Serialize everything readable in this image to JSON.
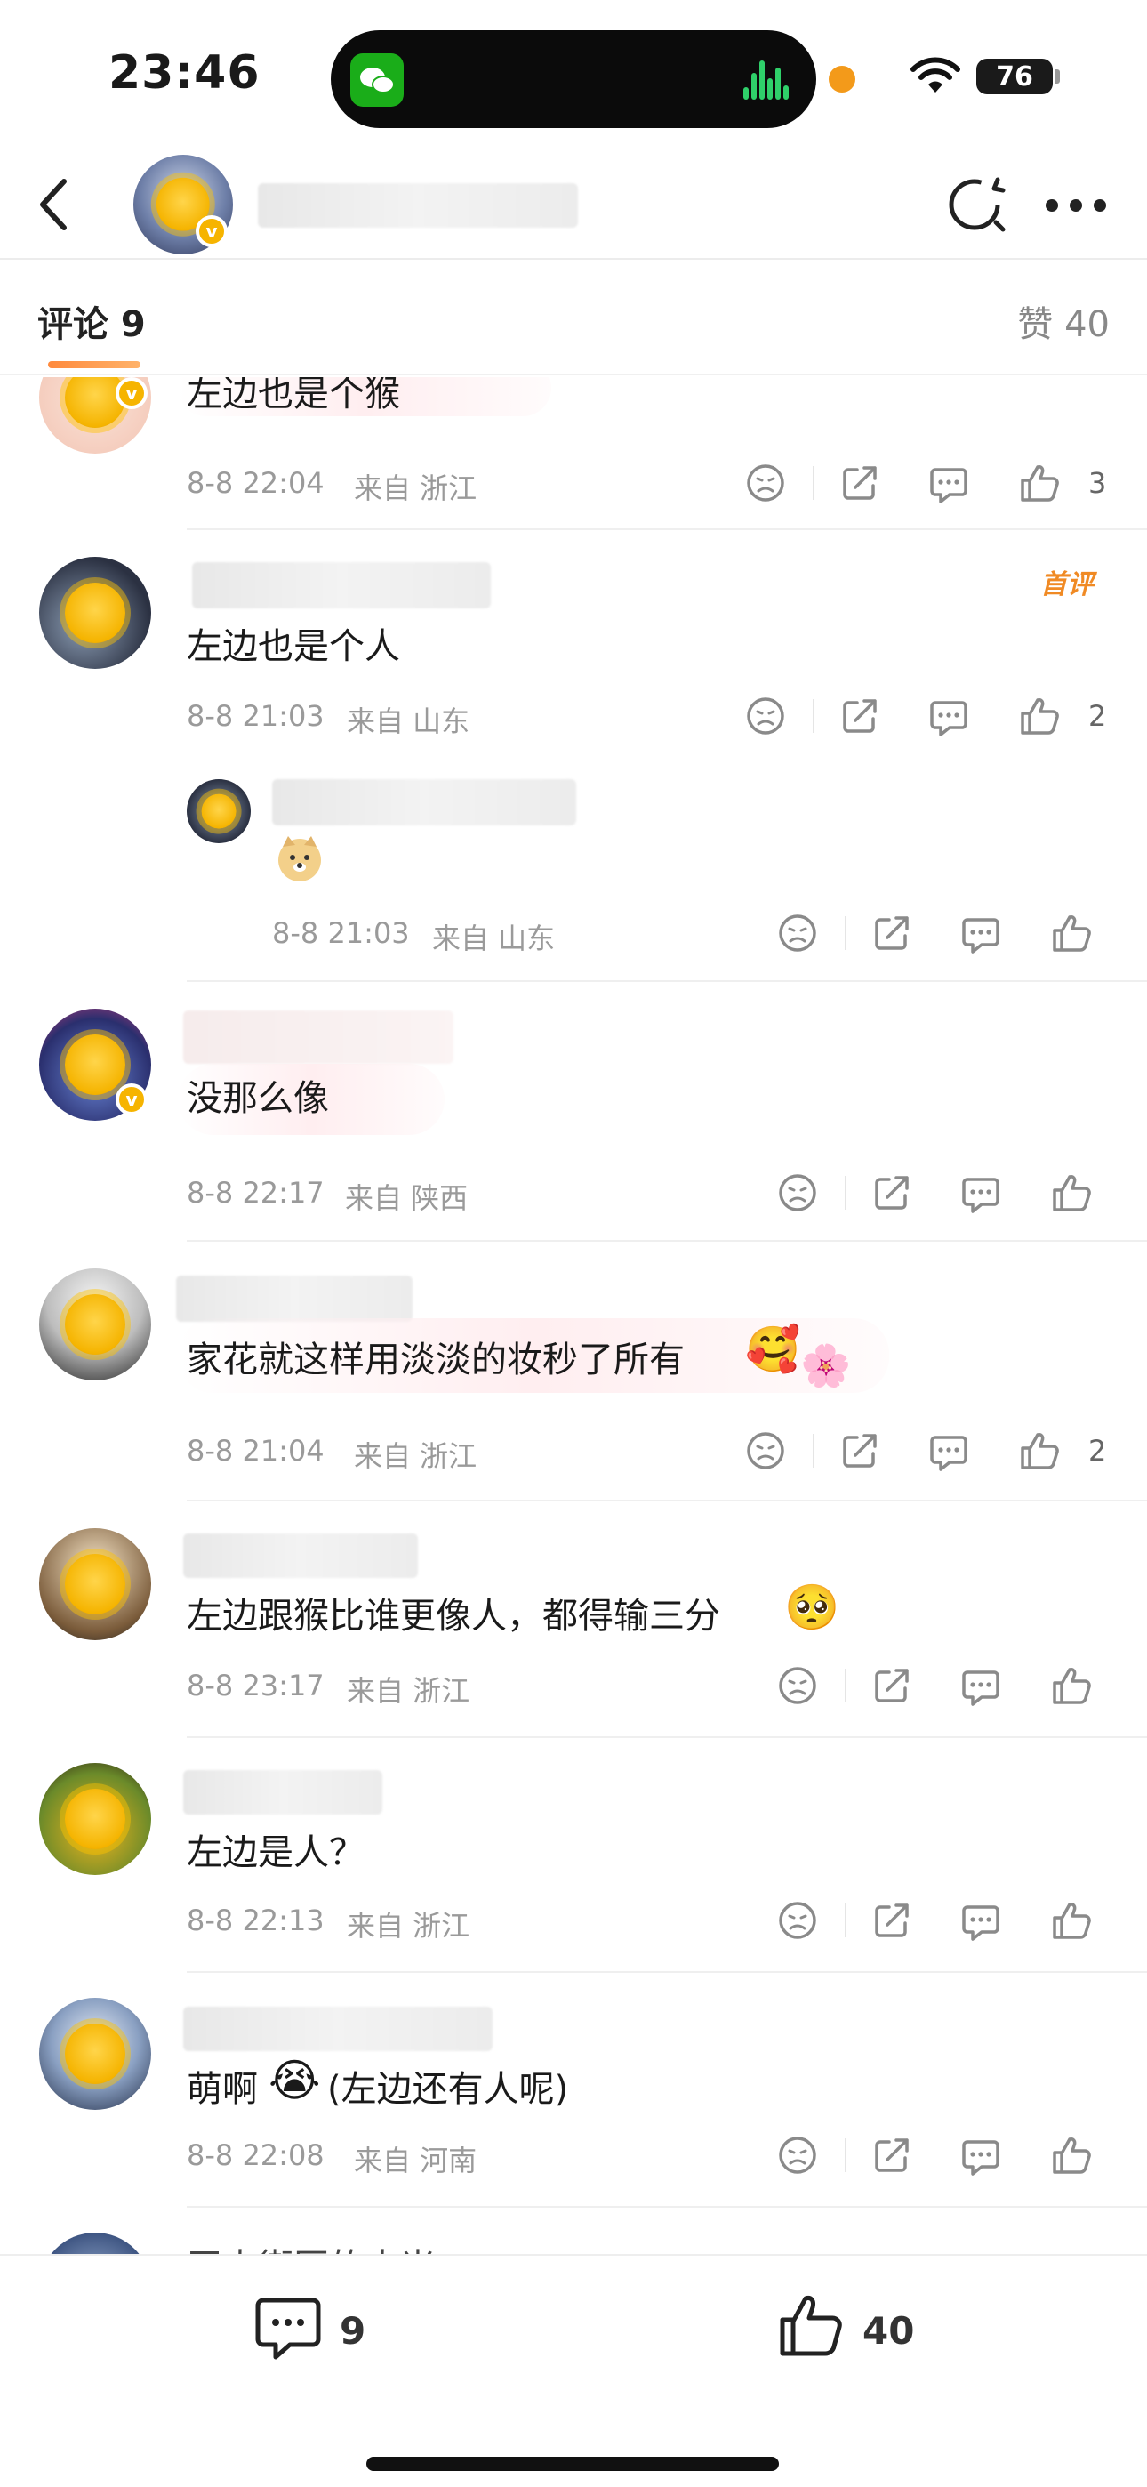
{
  "status": {
    "time": "23:46",
    "battery": "76"
  },
  "header": {
    "title": ""
  },
  "tabs": {
    "comments": "评论 9",
    "likes": "赞 40"
  },
  "comments": [
    {
      "text": "左边也是个猴",
      "time": "8-8 22:04",
      "location": "来自 浙江",
      "likes": "3"
    },
    {
      "text": "左边也是个人",
      "time": "8-8 21:03",
      "location": "来自 山东",
      "likes": "2",
      "badge": "首评"
    },
    {
      "text": "",
      "time": "8-8 21:03",
      "location": "来自 山东",
      "likes": ""
    },
    {
      "text": "没那么像",
      "time": "8-8 22:17",
      "location": "来自 陕西",
      "likes": ""
    },
    {
      "text": "家花就这样用淡淡的妆秒了所有",
      "time": "8-8 21:04",
      "location": "来自 浙江",
      "likes": "2"
    },
    {
      "text": "左边跟猴比谁更像人，都得输三分",
      "time": "8-8 23:17",
      "location": "来自 浙江",
      "likes": ""
    },
    {
      "text": "左边是人？",
      "time": "8-8 22:13",
      "location": "来自 浙江",
      "likes": ""
    },
    {
      "text": "萌啊",
      "text2": "(左边还有人呢)",
      "time": "8-8 22:08",
      "location": "来自 河南",
      "likes": ""
    },
    {
      "text": "玉太街区的大米"
    }
  ],
  "bottom": {
    "comment_count": "9",
    "like_count": "40"
  },
  "colors": {
    "accent": "#f08a24",
    "meta": "#9a9a9a",
    "verified": "#f6b400"
  }
}
